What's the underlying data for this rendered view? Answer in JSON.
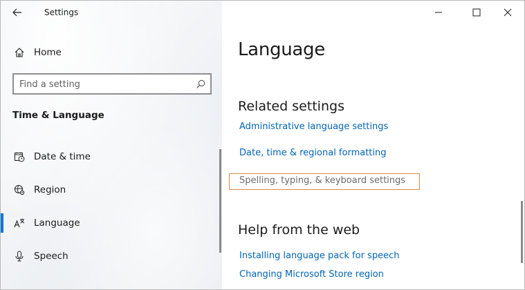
{
  "window": {
    "app_title": "Settings",
    "controls": {
      "minimize": "minimize",
      "maximize": "maximize",
      "close": "close"
    }
  },
  "sidebar": {
    "home_label": "Home",
    "search": {
      "placeholder": "Find a setting",
      "value": ""
    },
    "section_title": "Time & Language",
    "items": [
      {
        "label": "Date & time",
        "icon": "calendar-clock-icon",
        "selected": false
      },
      {
        "label": "Region",
        "icon": "globe-gear-icon",
        "selected": false
      },
      {
        "label": "Language",
        "icon": "language-icon",
        "selected": true
      },
      {
        "label": "Speech",
        "icon": "microphone-icon",
        "selected": false
      }
    ]
  },
  "main": {
    "page_title": "Language",
    "related": {
      "title": "Related settings",
      "links": [
        "Administrative language settings",
        "Date, time & regional formatting",
        "Spelling, typing, & keyboard settings"
      ]
    },
    "help": {
      "title": "Help from the web",
      "links": [
        "Installing language pack for speech",
        "Changing Microsoft Store region"
      ]
    }
  },
  "colors": {
    "accent": "#0078d7",
    "link": "#0064b4",
    "focus_outline": "#e08a43"
  }
}
